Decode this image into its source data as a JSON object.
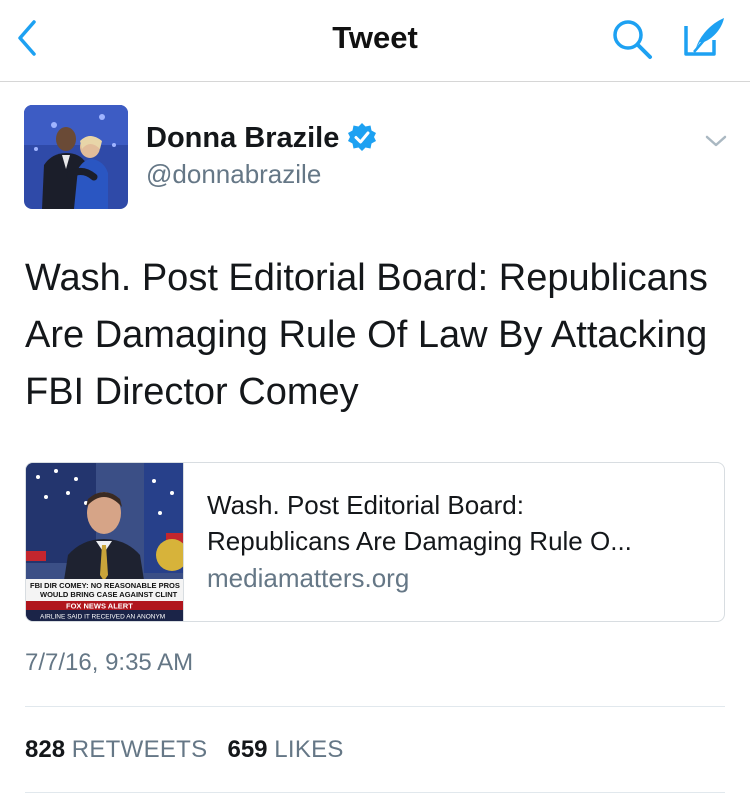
{
  "header": {
    "title": "Tweet"
  },
  "author": {
    "name": "Donna Brazile",
    "handle": "@donnabrazile",
    "verified": true
  },
  "tweet": {
    "text": "Wash. Post Editorial Board: Republicans Are Damaging Rule Of Law By Attacking FBI Director Comey",
    "timestamp": "7/7/16, 9:35 AM"
  },
  "card": {
    "title_line1": "Wash. Post Editorial Board:",
    "title_line2": "Republicans Are Damaging Rule O...",
    "domain": "mediamatters.org",
    "thumbnail": {
      "chyron_line1": "FBI DIR COMEY: NO REASONABLE PROS",
      "chyron_line2": "WOULD BRING CASE AGAINST CLINT",
      "alert": "FOX NEWS ALERT",
      "ticker": "AIRLINE SAID IT RECEIVED AN ANONYM"
    }
  },
  "stats": {
    "retweets_count": "828",
    "retweets_label": "RETWEETS",
    "likes_count": "659",
    "likes_label": "LIKES"
  },
  "colors": {
    "accent": "#1da1f2",
    "text": "#14171a",
    "secondary": "#657786",
    "border": "#d8dde1"
  },
  "icons": [
    "back-icon",
    "search-icon",
    "compose-icon",
    "verified-icon",
    "chevron-down-icon"
  ]
}
